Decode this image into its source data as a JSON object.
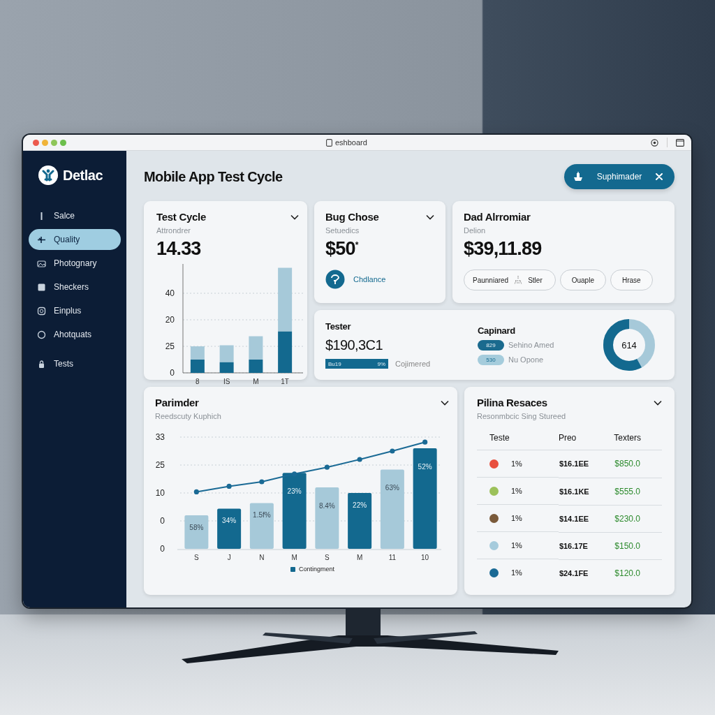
{
  "window": {
    "title": "eshboard"
  },
  "brand": {
    "name": "Detlac"
  },
  "sidebar": {
    "items": [
      {
        "label": "Salce",
        "selected": false
      },
      {
        "label": "Quality",
        "selected": true
      },
      {
        "label": "Photognary",
        "selected": false
      },
      {
        "label": "Sheckers",
        "selected": false
      },
      {
        "label": "Einplus",
        "selected": false
      },
      {
        "label": "Ahotquats",
        "selected": false
      },
      {
        "label": "Tests",
        "selected": false
      }
    ]
  },
  "header": {
    "title": "Mobile App Test Cycle",
    "action_button": "Suphimader"
  },
  "test_cycle": {
    "title": "Test Cycle",
    "subtitle": "Attrondrer",
    "value": "14.33",
    "chart": {
      "y_axis_labels": [
        "40",
        "20",
        "25",
        "0"
      ],
      "x_axis_labels": [
        "8",
        "IS",
        "M",
        "1T"
      ]
    }
  },
  "bug_chose": {
    "title": "Bug Chose",
    "subtitle": "Setuedics",
    "value": "$50$^{*}$",
    "link": "Chdlance"
  },
  "dad": {
    "title": "Dad Alrromiar",
    "subtitle": "Delion",
    "value": "$39,11.89",
    "chips": [
      {
        "label": "Paunniared",
        "extra": "Stler"
      },
      {
        "label": "Ouaple"
      },
      {
        "label": "Hrase"
      }
    ]
  },
  "tester": {
    "title": "Tester",
    "value": "$190,3C1",
    "progress": {
      "label": "Bu19",
      "reading": "9%",
      "level": 1
    },
    "caption": "Cojimered"
  },
  "capinard": {
    "title": "Capinard",
    "items": [
      {
        "badge": "829",
        "label": "Sehino Amed",
        "color": "#1a6a8e"
      },
      {
        "badge": "530",
        "label": "Nu Opone",
        "color": "#a5ccdc"
      }
    ],
    "donut": {
      "value": "614",
      "level": 0.58
    }
  },
  "parimder": {
    "title": "Parimder",
    "subtitle": "Reedscuty Kuphich",
    "chart": {
      "y_axis_labels": [
        "33",
        "25",
        "10",
        "0",
        "0"
      ],
      "x_axis_labels": [
        "S",
        "J",
        "N",
        "M",
        "S",
        "M",
        "11",
        "10"
      ],
      "bar_labels": [
        "58%",
        "34%",
        "1.5f%",
        "23%",
        "8.4%",
        "22%",
        "63%",
        "52%"
      ],
      "legend": "Contingment"
    }
  },
  "pilina": {
    "title": "Pilina Resaces",
    "subtitle": "Resonmbcic Sing Stureed",
    "table": {
      "columns": [
        "Teste",
        "Preo",
        "Texters"
      ],
      "rows": [
        {
          "color": "#e8503f",
          "share": "1%",
          "price": "$16.1EE",
          "total": "$850.0"
        },
        {
          "color": "#9cc15a",
          "share": "1%",
          "price": "$16.1KE",
          "total": "$555.0"
        },
        {
          "color": "#7a5a3a",
          "share": "1%",
          "price": "$14.1EE",
          "total": "$230.0"
        },
        {
          "color": "#a6cbdc",
          "share": "1%",
          "price": "$16.17E",
          "total": "$150.0"
        },
        {
          "color": "#1a6a95",
          "share": "1%",
          "price": "$24.1FE",
          "total": "$120.0"
        }
      ]
    }
  }
}
